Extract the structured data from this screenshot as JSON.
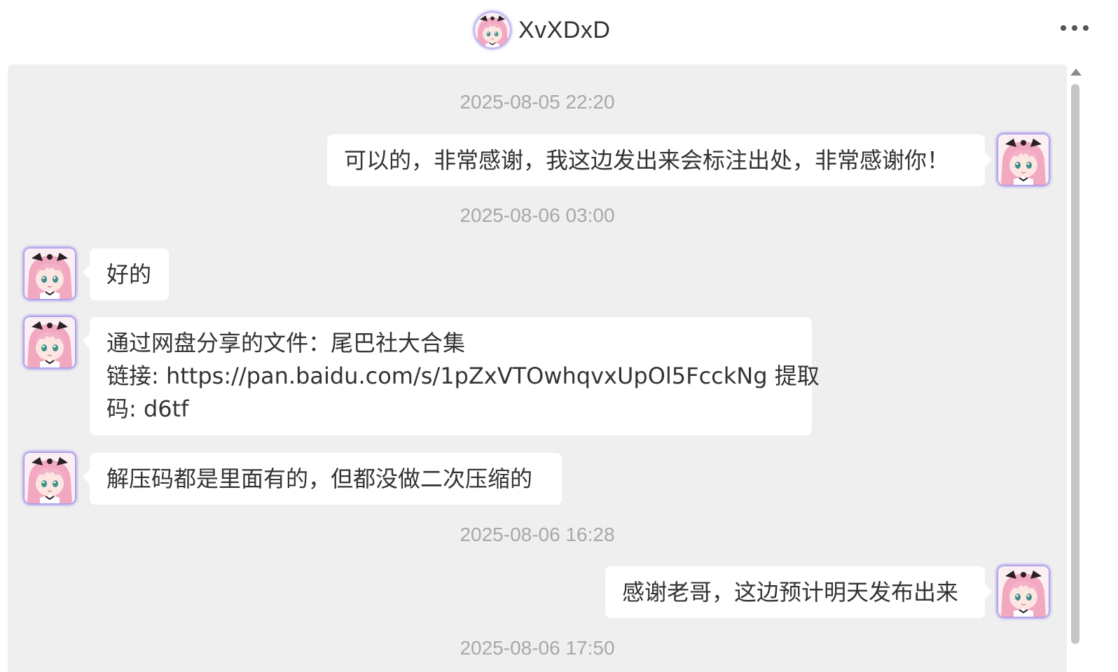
{
  "header": {
    "title": "XvXDxD",
    "avatar_icon": "anime-girl-avatar-icon",
    "menu_icon": "more-horizontal-icon"
  },
  "messages": {
    "ts1": "2025-08-05 22:20",
    "msg1": "可以的，非常感谢，我这边发出来会标注出处，非常感谢你！",
    "ts2": "2025-08-06 03:00",
    "msg2": "好的",
    "msg3_line1": "通过网盘分享的文件：尾巴社大合集",
    "msg3_line2": "链接: https://pan.baidu.com/s/1pZxVTOwhqvxUpOl5FcckNg 提取",
    "msg3_line3": "码: d6tf",
    "msg4": "解压码都是里面有的，但都没做二次压缩的",
    "ts3": "2025-08-06 16:28",
    "msg5": "感谢老哥，这边预计明天发布出来",
    "ts4": "2025-08-06 17:50"
  },
  "colors": {
    "panel_bg": "#efefef",
    "bubble_bg": "#ffffff",
    "timestamp": "#a8a8a8",
    "avatar_glow": "#7864e6",
    "avatar_hair": "#f2a8c0"
  }
}
